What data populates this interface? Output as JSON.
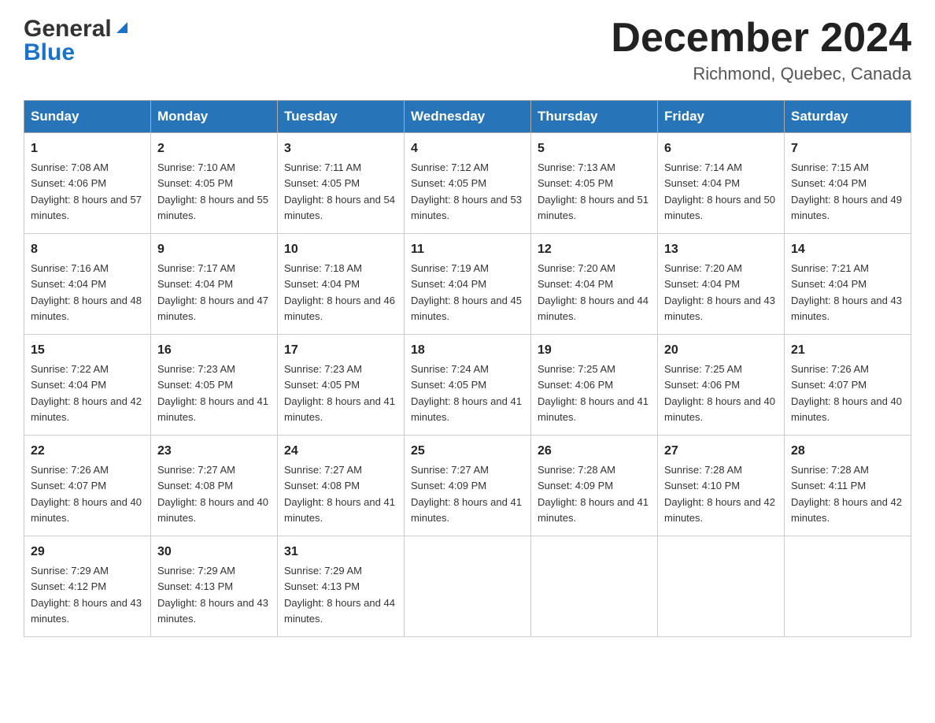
{
  "logo": {
    "general": "General",
    "blue": "Blue"
  },
  "title": "December 2024",
  "location": "Richmond, Quebec, Canada",
  "days_of_week": [
    "Sunday",
    "Monday",
    "Tuesday",
    "Wednesday",
    "Thursday",
    "Friday",
    "Saturday"
  ],
  "weeks": [
    [
      {
        "day": "1",
        "sunrise": "Sunrise: 7:08 AM",
        "sunset": "Sunset: 4:06 PM",
        "daylight": "Daylight: 8 hours and 57 minutes."
      },
      {
        "day": "2",
        "sunrise": "Sunrise: 7:10 AM",
        "sunset": "Sunset: 4:05 PM",
        "daylight": "Daylight: 8 hours and 55 minutes."
      },
      {
        "day": "3",
        "sunrise": "Sunrise: 7:11 AM",
        "sunset": "Sunset: 4:05 PM",
        "daylight": "Daylight: 8 hours and 54 minutes."
      },
      {
        "day": "4",
        "sunrise": "Sunrise: 7:12 AM",
        "sunset": "Sunset: 4:05 PM",
        "daylight": "Daylight: 8 hours and 53 minutes."
      },
      {
        "day": "5",
        "sunrise": "Sunrise: 7:13 AM",
        "sunset": "Sunset: 4:05 PM",
        "daylight": "Daylight: 8 hours and 51 minutes."
      },
      {
        "day": "6",
        "sunrise": "Sunrise: 7:14 AM",
        "sunset": "Sunset: 4:04 PM",
        "daylight": "Daylight: 8 hours and 50 minutes."
      },
      {
        "day": "7",
        "sunrise": "Sunrise: 7:15 AM",
        "sunset": "Sunset: 4:04 PM",
        "daylight": "Daylight: 8 hours and 49 minutes."
      }
    ],
    [
      {
        "day": "8",
        "sunrise": "Sunrise: 7:16 AM",
        "sunset": "Sunset: 4:04 PM",
        "daylight": "Daylight: 8 hours and 48 minutes."
      },
      {
        "day": "9",
        "sunrise": "Sunrise: 7:17 AM",
        "sunset": "Sunset: 4:04 PM",
        "daylight": "Daylight: 8 hours and 47 minutes."
      },
      {
        "day": "10",
        "sunrise": "Sunrise: 7:18 AM",
        "sunset": "Sunset: 4:04 PM",
        "daylight": "Daylight: 8 hours and 46 minutes."
      },
      {
        "day": "11",
        "sunrise": "Sunrise: 7:19 AM",
        "sunset": "Sunset: 4:04 PM",
        "daylight": "Daylight: 8 hours and 45 minutes."
      },
      {
        "day": "12",
        "sunrise": "Sunrise: 7:20 AM",
        "sunset": "Sunset: 4:04 PM",
        "daylight": "Daylight: 8 hours and 44 minutes."
      },
      {
        "day": "13",
        "sunrise": "Sunrise: 7:20 AM",
        "sunset": "Sunset: 4:04 PM",
        "daylight": "Daylight: 8 hours and 43 minutes."
      },
      {
        "day": "14",
        "sunrise": "Sunrise: 7:21 AM",
        "sunset": "Sunset: 4:04 PM",
        "daylight": "Daylight: 8 hours and 43 minutes."
      }
    ],
    [
      {
        "day": "15",
        "sunrise": "Sunrise: 7:22 AM",
        "sunset": "Sunset: 4:04 PM",
        "daylight": "Daylight: 8 hours and 42 minutes."
      },
      {
        "day": "16",
        "sunrise": "Sunrise: 7:23 AM",
        "sunset": "Sunset: 4:05 PM",
        "daylight": "Daylight: 8 hours and 41 minutes."
      },
      {
        "day": "17",
        "sunrise": "Sunrise: 7:23 AM",
        "sunset": "Sunset: 4:05 PM",
        "daylight": "Daylight: 8 hours and 41 minutes."
      },
      {
        "day": "18",
        "sunrise": "Sunrise: 7:24 AM",
        "sunset": "Sunset: 4:05 PM",
        "daylight": "Daylight: 8 hours and 41 minutes."
      },
      {
        "day": "19",
        "sunrise": "Sunrise: 7:25 AM",
        "sunset": "Sunset: 4:06 PM",
        "daylight": "Daylight: 8 hours and 41 minutes."
      },
      {
        "day": "20",
        "sunrise": "Sunrise: 7:25 AM",
        "sunset": "Sunset: 4:06 PM",
        "daylight": "Daylight: 8 hours and 40 minutes."
      },
      {
        "day": "21",
        "sunrise": "Sunrise: 7:26 AM",
        "sunset": "Sunset: 4:07 PM",
        "daylight": "Daylight: 8 hours and 40 minutes."
      }
    ],
    [
      {
        "day": "22",
        "sunrise": "Sunrise: 7:26 AM",
        "sunset": "Sunset: 4:07 PM",
        "daylight": "Daylight: 8 hours and 40 minutes."
      },
      {
        "day": "23",
        "sunrise": "Sunrise: 7:27 AM",
        "sunset": "Sunset: 4:08 PM",
        "daylight": "Daylight: 8 hours and 40 minutes."
      },
      {
        "day": "24",
        "sunrise": "Sunrise: 7:27 AM",
        "sunset": "Sunset: 4:08 PM",
        "daylight": "Daylight: 8 hours and 41 minutes."
      },
      {
        "day": "25",
        "sunrise": "Sunrise: 7:27 AM",
        "sunset": "Sunset: 4:09 PM",
        "daylight": "Daylight: 8 hours and 41 minutes."
      },
      {
        "day": "26",
        "sunrise": "Sunrise: 7:28 AM",
        "sunset": "Sunset: 4:09 PM",
        "daylight": "Daylight: 8 hours and 41 minutes."
      },
      {
        "day": "27",
        "sunrise": "Sunrise: 7:28 AM",
        "sunset": "Sunset: 4:10 PM",
        "daylight": "Daylight: 8 hours and 42 minutes."
      },
      {
        "day": "28",
        "sunrise": "Sunrise: 7:28 AM",
        "sunset": "Sunset: 4:11 PM",
        "daylight": "Daylight: 8 hours and 42 minutes."
      }
    ],
    [
      {
        "day": "29",
        "sunrise": "Sunrise: 7:29 AM",
        "sunset": "Sunset: 4:12 PM",
        "daylight": "Daylight: 8 hours and 43 minutes."
      },
      {
        "day": "30",
        "sunrise": "Sunrise: 7:29 AM",
        "sunset": "Sunset: 4:13 PM",
        "daylight": "Daylight: 8 hours and 43 minutes."
      },
      {
        "day": "31",
        "sunrise": "Sunrise: 7:29 AM",
        "sunset": "Sunset: 4:13 PM",
        "daylight": "Daylight: 8 hours and 44 minutes."
      },
      null,
      null,
      null,
      null
    ]
  ]
}
